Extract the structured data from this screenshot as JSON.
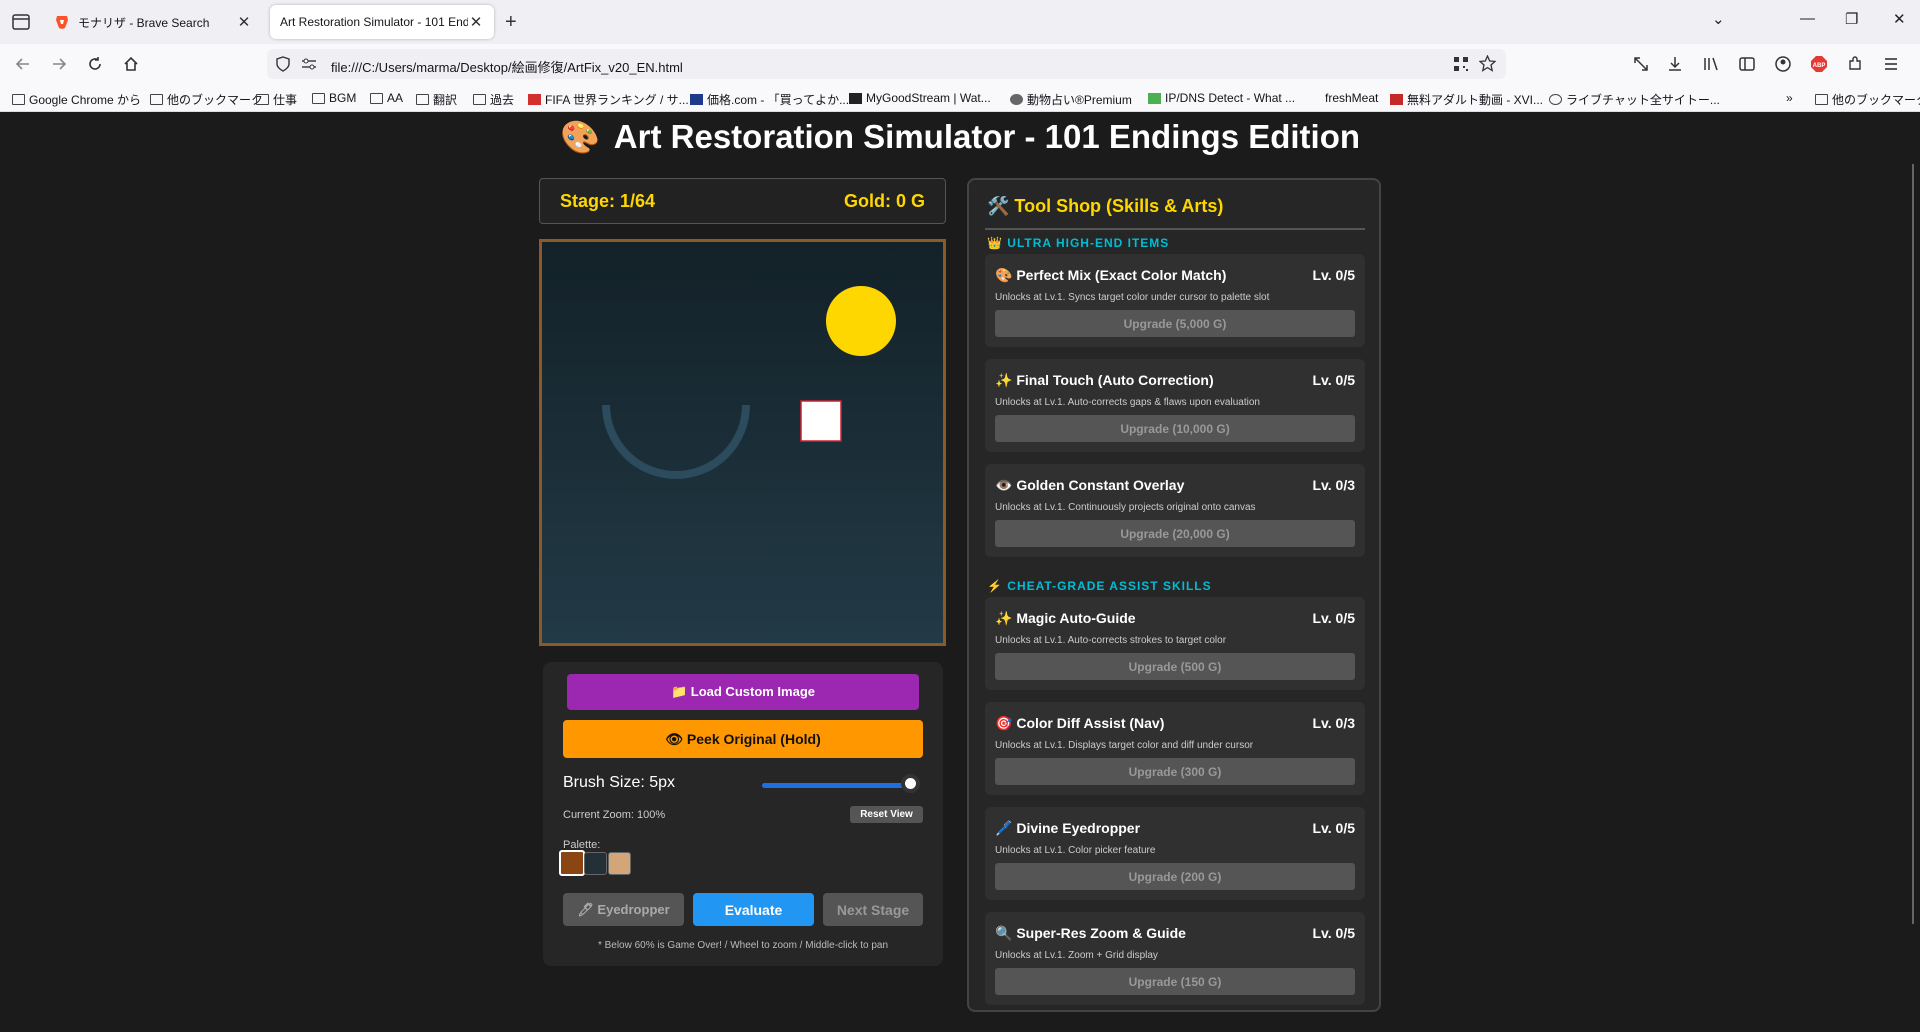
{
  "browser": {
    "tabs": [
      {
        "title": "モナリザ - Brave Search",
        "favicon": "brave-lion-icon"
      },
      {
        "title": "Art Restoration Simulator - 101 End",
        "favicon": "none"
      }
    ],
    "url": "file:///C:/Users/marma/Desktop/絵画修復/ArtFix_v20_EN.html",
    "bookmarks": [
      "Google Chrome から",
      "他のブックマーク",
      "仕事",
      "BGM",
      "AA",
      "翻訳",
      "過去",
      "FIFA 世界ランキング / サ...",
      "価格.com - 「買ってよか...",
      "MyGoodStream | Wat...",
      "動物占い®Premium",
      "IP/DNS Detect - What ...",
      "freshMeat",
      "無料アダルト動画 - XVI...",
      "ライブチャット全サイトー..."
    ],
    "other_bookmarks": "他のブックマーク"
  },
  "game": {
    "title": "Art Restoration Simulator - 101 Endings Edition",
    "title_icon": "palette-icon",
    "stage": "Stage: 1/64",
    "gold": "Gold: 0 G",
    "canvas": {
      "background_top": "#132128",
      "background_bottom": "#223a46",
      "sun_color": "#ffd700",
      "arc_color": "#2c4b5c",
      "square_fill": "#ffffff",
      "square_border": "#cc2233",
      "frame_color": "#8b5a2b"
    },
    "controls": {
      "load_label": "📁 Load Custom Image",
      "peek_label": "👁 Peek Original (Hold)",
      "brush_label": "Brush Size: 5px",
      "brush_level": 1.0,
      "zoom_label": "Current Zoom: 100%",
      "reset_label": "Reset View",
      "palette_label": "Palette:",
      "palette": [
        "#8b4513",
        "#243038",
        "#d2a679"
      ],
      "eyedropper_label": "🖊 Eyedropper",
      "evaluate_label": "Evaluate",
      "next_label": "Next Stage",
      "hint": "* Below 60% is Game Over! / Wheel to zoom / Middle-click to pan"
    }
  },
  "shop": {
    "title": "🛠️ Tool Shop (Skills & Arts)",
    "sections": [
      {
        "icon": "👑",
        "heading": "ULTRA HIGH-END ITEMS",
        "items": [
          {
            "icon": "🎨",
            "name": "Perfect Mix (Exact Color Match)",
            "level": "Lv. 0/5",
            "desc": "Unlocks at Lv.1. Syncs target color under cursor to palette slot",
            "button": "Upgrade (5,000 G)"
          },
          {
            "icon": "✨",
            "name": "Final Touch (Auto Correction)",
            "level": "Lv. 0/5",
            "desc": "Unlocks at Lv.1. Auto-corrects gaps & flaws upon evaluation",
            "button": "Upgrade (10,000 G)"
          },
          {
            "icon": "👁️",
            "name": "Golden Constant Overlay",
            "level": "Lv. 0/3",
            "desc": "Unlocks at Lv.1. Continuously projects original onto canvas",
            "button": "Upgrade (20,000 G)"
          }
        ]
      },
      {
        "icon": "⚡",
        "heading": "CHEAT-GRADE ASSIST SKILLS",
        "items": [
          {
            "icon": "✨",
            "name": "Magic Auto-Guide",
            "level": "Lv. 0/5",
            "desc": "Unlocks at Lv.1. Auto-corrects strokes to target color",
            "button": "Upgrade (500 G)"
          },
          {
            "icon": "🎯",
            "name": "Color Diff Assist (Nav)",
            "level": "Lv. 0/3",
            "desc": "Unlocks at Lv.1. Displays target color and diff under cursor",
            "button": "Upgrade (300 G)"
          },
          {
            "icon": "🖊️",
            "name": "Divine Eyedropper",
            "level": "Lv. 0/5",
            "desc": "Unlocks at Lv.1. Color picker feature",
            "button": "Upgrade (200 G)"
          },
          {
            "icon": "🔍",
            "name": "Super-Res Zoom & Guide",
            "level": "Lv. 0/5",
            "desc": "Unlocks at Lv.1. Zoom + Grid display",
            "button": "Upgrade (150 G)"
          }
        ]
      }
    ]
  }
}
